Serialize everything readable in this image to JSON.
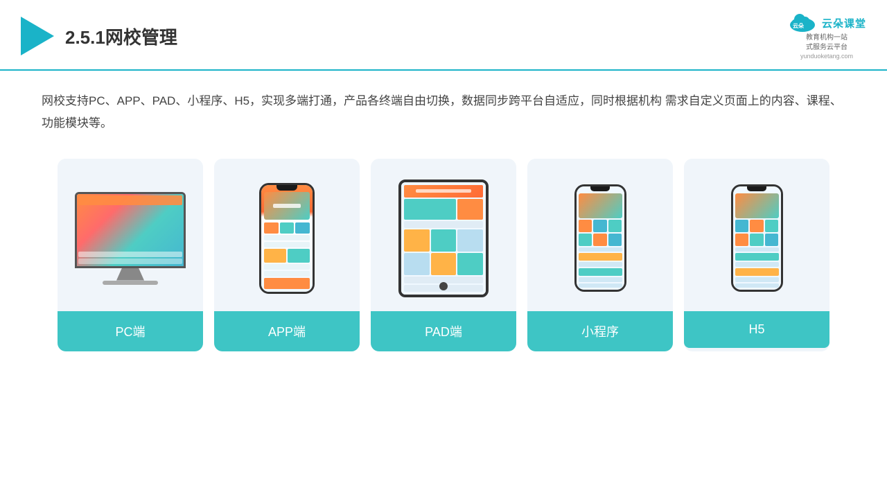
{
  "header": {
    "title": "2.5.1网校管理",
    "brand_name": "云朵课堂",
    "brand_slogan": "教育机构一站\n式服务云平台",
    "brand_url": "yunduoketang.com"
  },
  "description": {
    "text": "网校支持PC、APP、PAD、小程序、H5，实现多端打通，产品各终端自由切换，数据同步跨平台自适应，同时根据机构\n需求自定义页面上的内容、课程、功能模块等。"
  },
  "cards": [
    {
      "id": "pc",
      "label": "PC端"
    },
    {
      "id": "app",
      "label": "APP端"
    },
    {
      "id": "pad",
      "label": "PAD端"
    },
    {
      "id": "miniprogram",
      "label": "小程序"
    },
    {
      "id": "h5",
      "label": "H5"
    }
  ],
  "colors": {
    "accent": "#1ab3c8",
    "card_bg": "#f0f5fa",
    "card_label_bg": "#3ec5c5",
    "card_label_text": "#ffffff"
  }
}
